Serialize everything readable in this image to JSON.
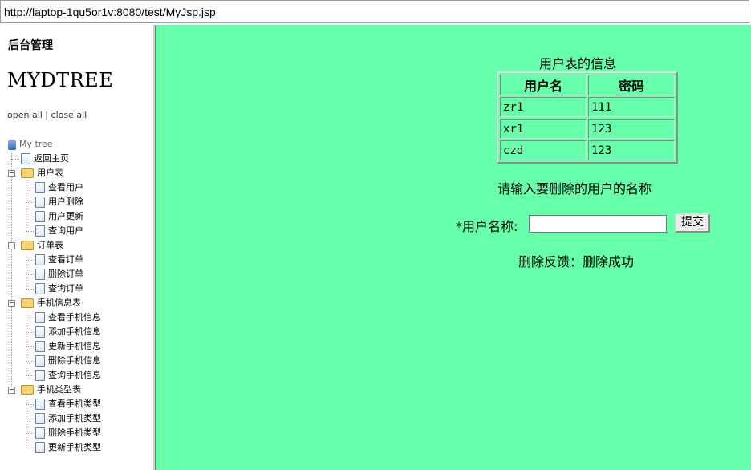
{
  "address_bar": {
    "url": "http://laptop-1qu5or1v:8080/test/MyJsp.jsp"
  },
  "sidebar": {
    "admin_title": "后台管理",
    "tree_title": "MYDTREE",
    "open_all": "open all",
    "separator": " | ",
    "close_all": "close all",
    "root": "My tree",
    "home": "返回主页",
    "groups": [
      {
        "label": "用户表",
        "items": [
          "查看用户",
          "用户删除",
          "用户更新",
          "查询用户"
        ]
      },
      {
        "label": "订单表",
        "items": [
          "查看订单",
          "删除订单",
          "查询订单"
        ]
      },
      {
        "label": "手机信息表",
        "items": [
          "查看手机信息",
          "添加手机信息",
          "更新手机信息",
          "删除手机信息",
          "查询手机信息"
        ]
      },
      {
        "label": "手机类型表",
        "items": [
          "查看手机类型",
          "添加手机类型",
          "删除手机类型",
          "更新手机类型"
        ]
      }
    ]
  },
  "main": {
    "table_caption": "用户表的信息",
    "columns": [
      "用户名",
      "密码"
    ],
    "rows": [
      [
        "zr1",
        "111"
      ],
      [
        "xr1",
        "123"
      ],
      [
        "czd",
        "123"
      ]
    ],
    "prompt": "请输入要删除的用户的名称",
    "field_label": "*用户名称:",
    "input_value": "",
    "submit_label": "提交",
    "feedback": "删除反馈：删除成功"
  },
  "colors": {
    "content_bg": "#66ffaa"
  },
  "icons": {
    "root": "computer-icon",
    "page": "page-icon",
    "folder": "folder-icon",
    "toggle": "minus-toggle-icon"
  }
}
